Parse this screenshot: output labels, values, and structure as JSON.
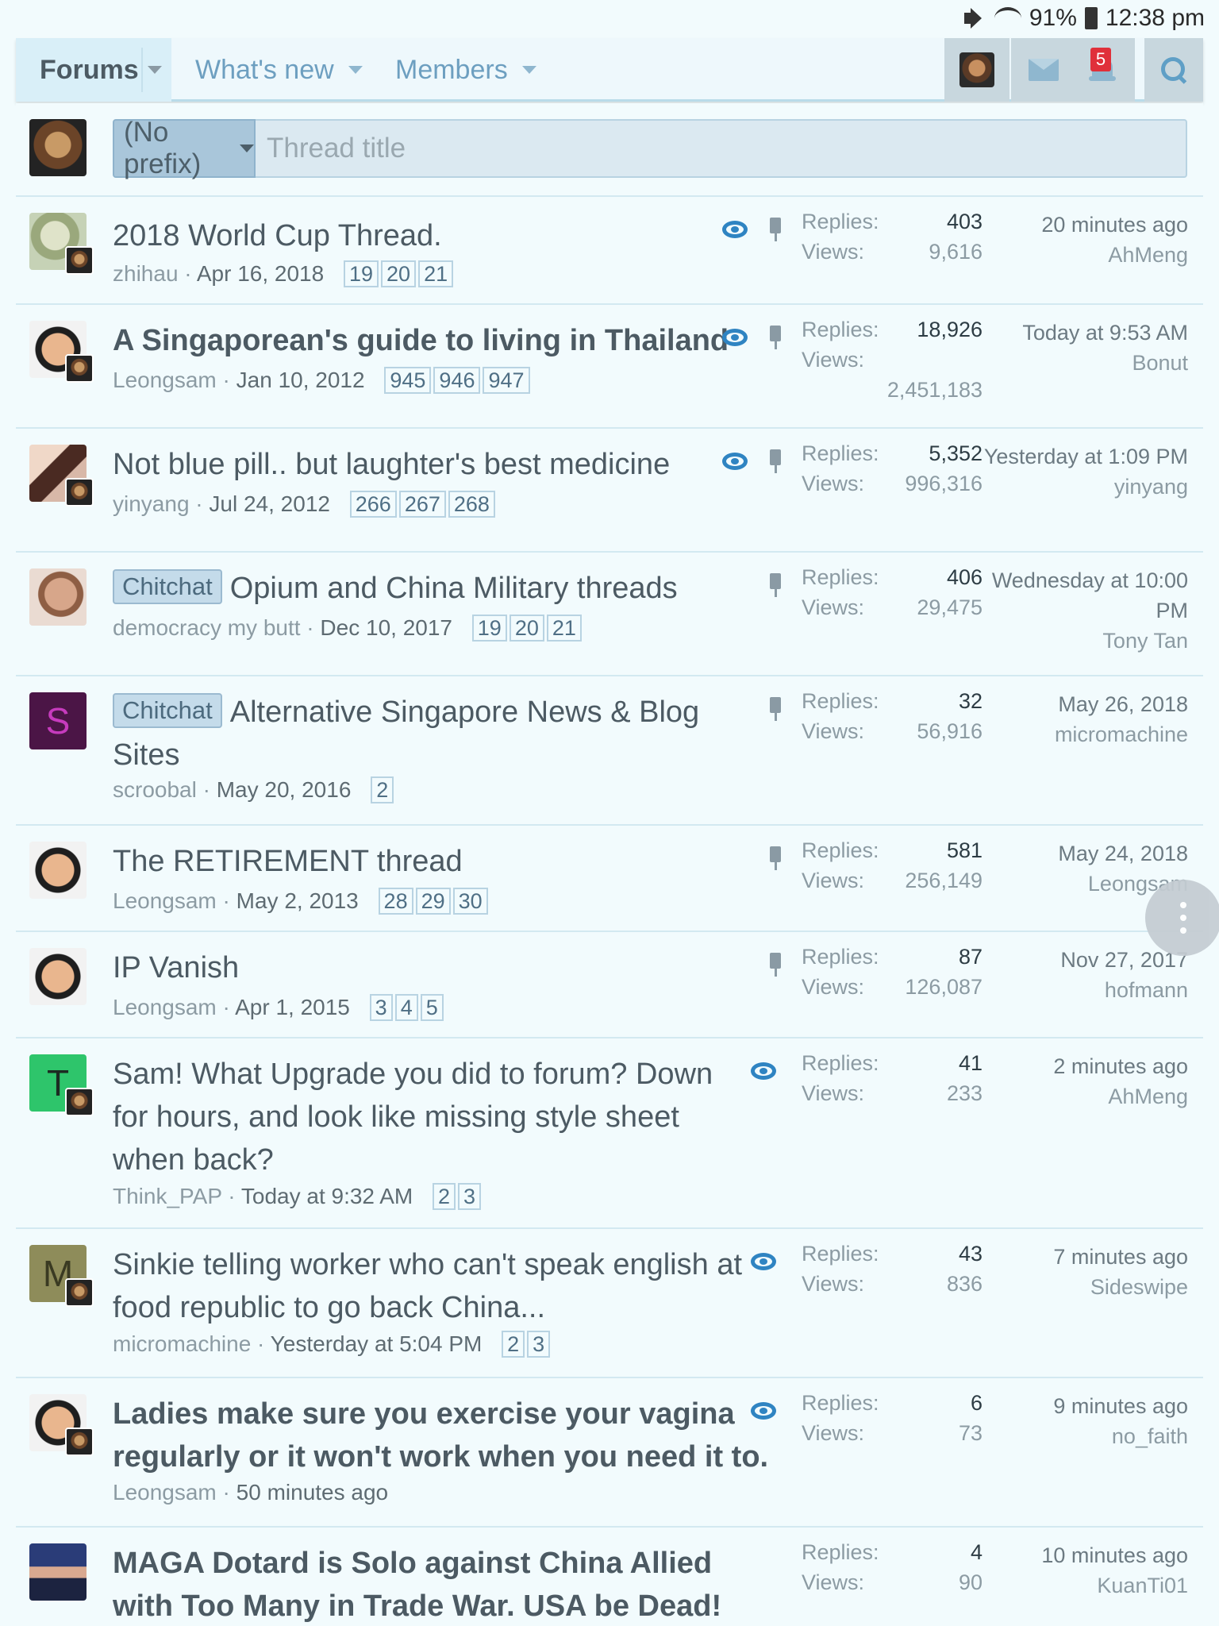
{
  "status_bar": {
    "battery": "91%",
    "time": "12:38 pm"
  },
  "nav": {
    "tabs": [
      {
        "label": "Forums"
      },
      {
        "label": "What's new"
      },
      {
        "label": "Members"
      }
    ],
    "alerts_count": "5"
  },
  "quick_thread": {
    "prefix_label": "(No prefix)",
    "title_placeholder": "Thread title"
  },
  "threads": [
    {
      "title": "2018 World Cup Thread.",
      "author": "zhihau",
      "date": "Apr 16, 2018",
      "pages": [
        "19",
        "20",
        "21"
      ],
      "replies_label": "Replies:",
      "replies": "403",
      "views_label": "Views:",
      "views": "9,616",
      "last_when": "20 minutes ago",
      "last_user": "AhMeng"
    },
    {
      "title": "A Singaporean's guide to living in Thailand",
      "author": "Leongsam",
      "date": "Jan 10, 2012",
      "pages": [
        "945",
        "946",
        "947"
      ],
      "replies_label": "Replies:",
      "replies": "18,926",
      "views_label": "Views:",
      "views": "2,451,183",
      "last_when": "Today at 9:53 AM",
      "last_user": "Bonut"
    },
    {
      "title": "Not blue pill.. but laughter's best medicine",
      "author": "yinyang",
      "date": "Jul 24, 2012",
      "pages": [
        "266",
        "267",
        "268"
      ],
      "replies_label": "Replies:",
      "replies": "5,352",
      "views_label": "Views:",
      "views": "996,316",
      "last_when": "Yesterday at 1:09 PM",
      "last_user": "yinyang"
    },
    {
      "prefix": "Chitchat",
      "title": "Opium and China Military threads",
      "author": "democracy my butt",
      "date": "Dec 10, 2017",
      "pages": [
        "19",
        "20",
        "21"
      ],
      "replies_label": "Replies:",
      "replies": "406",
      "views_label": "Views:",
      "views": "29,475",
      "last_when": "Wednesday at 10:00 PM",
      "last_user": "Tony Tan"
    },
    {
      "prefix": "Chitchat",
      "title": "Alternative Singapore News & Blog Sites",
      "author": "scroobal",
      "date": "May 20, 2016",
      "pages": [
        "2"
      ],
      "replies_label": "Replies:",
      "replies": "32",
      "views_label": "Views:",
      "views": "56,916",
      "last_when": "May 26, 2018",
      "last_user": "micromachine",
      "avatar_letter": "S"
    },
    {
      "title": "The RETIREMENT thread",
      "author": "Leongsam",
      "date": "May 2, 2013",
      "pages": [
        "28",
        "29",
        "30"
      ],
      "replies_label": "Replies:",
      "replies": "581",
      "views_label": "Views:",
      "views": "256,149",
      "last_when": "May 24, 2018",
      "last_user": "Leongsam"
    },
    {
      "title": "IP Vanish",
      "author": "Leongsam",
      "date": "Apr 1, 2015",
      "pages": [
        "3",
        "4",
        "5"
      ],
      "replies_label": "Replies:",
      "replies": "87",
      "views_label": "Views:",
      "views": "126,087",
      "last_when": "Nov 27, 2017",
      "last_user": "hofmann"
    },
    {
      "title": "Sam! What Upgrade you did to forum? Down for hours, and look like missing style sheet when back?",
      "author": "Think_PAP",
      "date": "Today at 9:32 AM",
      "pages": [
        "2",
        "3"
      ],
      "replies_label": "Replies:",
      "replies": "41",
      "views_label": "Views:",
      "views": "233",
      "last_when": "2 minutes ago",
      "last_user": "AhMeng",
      "avatar_letter": "T"
    },
    {
      "title": "Sinkie telling worker who can't speak english at food republic to go back China...",
      "author": "micromachine",
      "date": "Yesterday at 5:04 PM",
      "pages": [
        "2",
        "3"
      ],
      "replies_label": "Replies:",
      "replies": "43",
      "views_label": "Views:",
      "views": "836",
      "last_when": "7 minutes ago",
      "last_user": "Sideswipe",
      "avatar_letter": "M"
    },
    {
      "title": "Ladies make sure you exercise your vagina regularly or it won't work when you need it to.",
      "author": "Leongsam",
      "date": "50 minutes ago",
      "pages": [],
      "replies_label": "Replies:",
      "replies": "6",
      "views_label": "Views:",
      "views": "73",
      "last_when": "9 minutes ago",
      "last_user": "no_faith"
    },
    {
      "title": "MAGA Dotard is Solo against China Allied with Too Many in Trade War. USA be Dead!",
      "author": "",
      "date": "",
      "pages": [],
      "replies_label": "Replies:",
      "replies": "4",
      "views_label": "Views:",
      "views": "90",
      "last_when": "10 minutes ago",
      "last_user": "KuanTi01"
    }
  ]
}
